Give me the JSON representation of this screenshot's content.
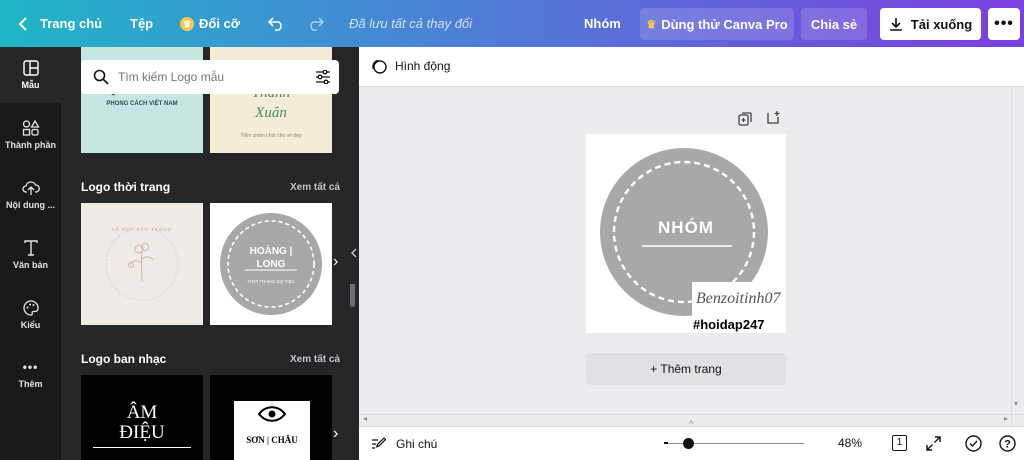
{
  "topbar": {
    "home_label": "Trang chủ",
    "file_label": "Tệp",
    "resize_label": "Đổi cỡ",
    "save_status": "Đã lưu tất cả thay đổi",
    "team_label": "Nhóm",
    "try_pro_label": "Dùng thử Canva Pro",
    "share_label": "Chia sẻ",
    "download_label": "Tải xuống"
  },
  "sidebar": {
    "items": [
      {
        "label": "Mẫu",
        "icon": "template-icon"
      },
      {
        "label": "Thành phần",
        "icon": "elements-icon"
      },
      {
        "label": "Nội dung ...",
        "icon": "upload-icon"
      },
      {
        "label": "Văn bản",
        "icon": "text-icon"
      },
      {
        "label": "Kiểu",
        "icon": "palette-icon"
      },
      {
        "label": "Thêm",
        "icon": "more-icon"
      }
    ]
  },
  "panel": {
    "search_placeholder": "Tìm kiếm Logo mẫu",
    "top_thumbs": [
      {
        "title": "QUÁN ĂC",
        "subtitle": "PHONG CÁCH VIỆT NAM"
      },
      {
        "title": "Thanh Xuân",
        "subtitle": "Tiệm chăm chút cho vẻ đẹp"
      }
    ],
    "sections": [
      {
        "title": "Logo thời trang",
        "see_all": "Xem tất cả",
        "thumbs": [
          {
            "name": "floral-logo",
            "text": "VẺ ĐẸP BÊN TRONG"
          },
          {
            "name": "hoang-long-logo",
            "title": "HOÀNG | LONG",
            "subtitle": "THỜI TRANG DỰ TIỆC"
          }
        ]
      },
      {
        "title": "Logo ban nhạc",
        "see_all": "Xem tất cả",
        "thumbs": [
          {
            "name": "am-dieu-logo",
            "title": "ÂM ĐIỆU"
          },
          {
            "name": "son-chau-logo",
            "title": "SƠN | CHÂU"
          }
        ]
      }
    ]
  },
  "toolbar": {
    "animate_label": "Hình động"
  },
  "canvas": {
    "logo_text": "NHÓM",
    "signature_text": "Benzoitinh07",
    "hashtag_text": "#hoidap247",
    "add_page_label": "+ Thêm trang"
  },
  "bottom": {
    "notes_label": "Ghi chú",
    "zoom_label": "48%",
    "zoom_level": 0.48,
    "page_count": "1"
  },
  "colors": {
    "accent_gradient_start": "#1fb6c7",
    "accent_gradient_end": "#7b3fe0",
    "logo_gray": "#a8a8a8"
  }
}
